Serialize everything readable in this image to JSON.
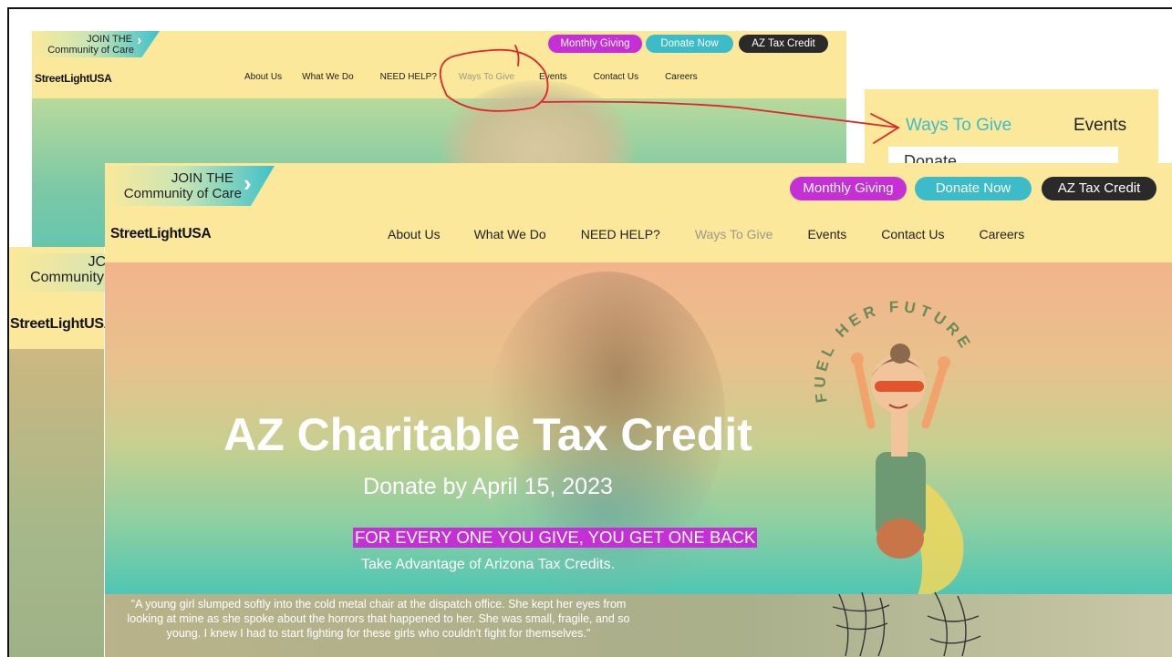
{
  "site": {
    "logo": "StreetLightUSA",
    "join": {
      "line1": "JOIN THE",
      "line2": "Community of Care"
    },
    "nav": [
      "About Us",
      "What We Do",
      "NEED HELP?",
      "Ways To Give",
      "Events",
      "Contact Us",
      "Careers"
    ],
    "buttons": {
      "monthly": "Monthly Giving",
      "donate": "Donate Now",
      "tax": "AZ Tax Credit"
    }
  },
  "side_crop": {
    "join_partial": "JC",
    "community_partial": "Community",
    "logo": "StreetLightUSA"
  },
  "zoom": {
    "ways": "Ways To Give",
    "events": "Events",
    "dropdown_partial": "Donate"
  },
  "hero": {
    "title": "AZ Charitable Tax Credit",
    "subtitle": "Donate by April 15, 2023",
    "highlight": "FOR EVERY ONE YOU GIVE, YOU GET ONE BACK",
    "tagline": "Take Advantage of Arizona Tax Credits.",
    "badge": "FUEL HER FUTURE"
  },
  "quote": {
    "line1": "\"A young girl slumped softly into the cold metal chair at the dispatch office. She kept her eyes from",
    "line2": "looking at mine as she spoke about the horrors that happened to her. She was small, fragile, and so",
    "line3": "young. I knew I had to start fighting for these girls who couldn't fight for themselves.\""
  },
  "colors": {
    "header": "#fbe89a",
    "magenta": "#c52fd6",
    "teal": "#3cbcc8",
    "dark": "#2a2a2a",
    "annotation": "#e0262b"
  }
}
